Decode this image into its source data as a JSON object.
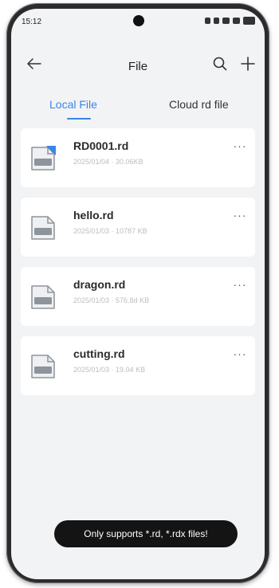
{
  "status_bar": {
    "time": "15:12"
  },
  "header": {
    "title": "File"
  },
  "tabs": [
    {
      "label": "Local File",
      "active": true
    },
    {
      "label": "Cloud rd file",
      "active": false
    }
  ],
  "files": [
    {
      "name": "RD0001.rd",
      "meta": "2025/01/04 · 30.06KB",
      "badge": true
    },
    {
      "name": "hello.rd",
      "meta": "2025/01/03 · 10787 KB",
      "badge": false
    },
    {
      "name": "dragon.rd",
      "meta": "2025/01/03 · 576.8d KB",
      "badge": false
    },
    {
      "name": "cutting.rd",
      "meta": "2025/01/03 · 19.04 KB",
      "badge": false
    }
  ],
  "more_label": "···",
  "toast": {
    "text": "Only supports *.rd, *.rdx files!"
  },
  "colors": {
    "accent": "#3a86e8",
    "toast_bg": "#141414",
    "background": "#f2f3f5"
  },
  "icons": [
    "back-arrow-icon",
    "search-icon",
    "plus-icon",
    "file-icon",
    "more-icon"
  ]
}
